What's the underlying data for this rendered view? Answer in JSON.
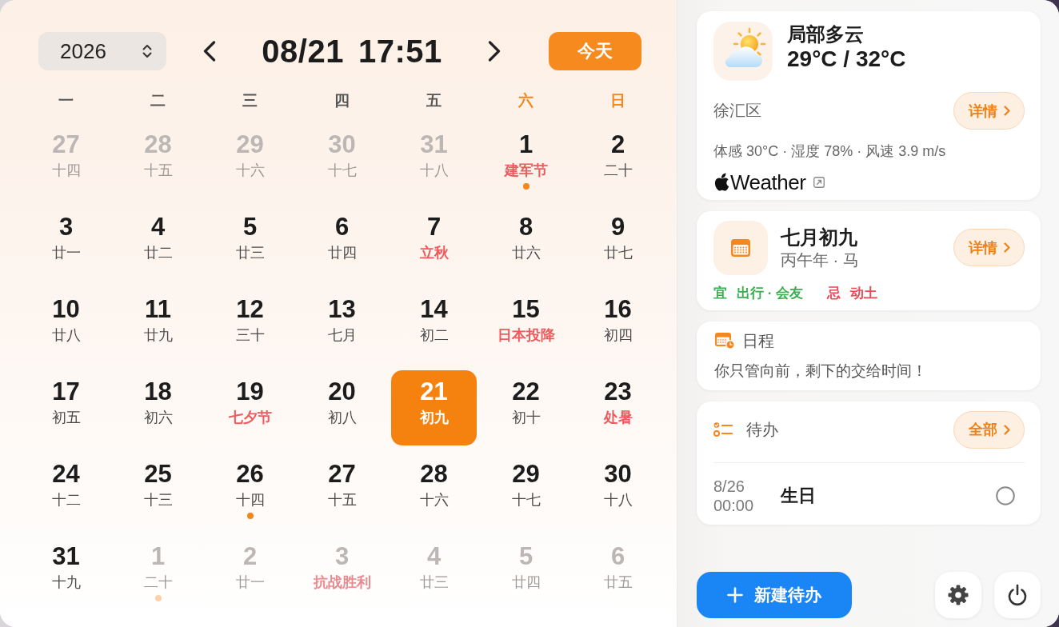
{
  "header": {
    "year": "2026",
    "date": "08/21",
    "time": "17:51",
    "today_button": "今天"
  },
  "weekdays": [
    {
      "label": "一",
      "weekend": false
    },
    {
      "label": "二",
      "weekend": false
    },
    {
      "label": "三",
      "weekend": false
    },
    {
      "label": "四",
      "weekend": false
    },
    {
      "label": "五",
      "weekend": false
    },
    {
      "label": "六",
      "weekend": true
    },
    {
      "label": "日",
      "weekend": true
    }
  ],
  "days": [
    {
      "day": "27",
      "lunar": "十四",
      "in_month": false,
      "festival": false,
      "event": false,
      "selected": false
    },
    {
      "day": "28",
      "lunar": "十五",
      "in_month": false,
      "festival": false,
      "event": false,
      "selected": false
    },
    {
      "day": "29",
      "lunar": "十六",
      "in_month": false,
      "festival": false,
      "event": false,
      "selected": false
    },
    {
      "day": "30",
      "lunar": "十七",
      "in_month": false,
      "festival": false,
      "event": false,
      "selected": false
    },
    {
      "day": "31",
      "lunar": "十八",
      "in_month": false,
      "festival": false,
      "event": false,
      "selected": false
    },
    {
      "day": "1",
      "lunar": "建军节",
      "in_month": true,
      "festival": true,
      "event": true,
      "selected": false
    },
    {
      "day": "2",
      "lunar": "二十",
      "in_month": true,
      "festival": false,
      "event": false,
      "selected": false
    },
    {
      "day": "3",
      "lunar": "廿一",
      "in_month": true,
      "festival": false,
      "event": false,
      "selected": false
    },
    {
      "day": "4",
      "lunar": "廿二",
      "in_month": true,
      "festival": false,
      "event": false,
      "selected": false
    },
    {
      "day": "5",
      "lunar": "廿三",
      "in_month": true,
      "festival": false,
      "event": false,
      "selected": false
    },
    {
      "day": "6",
      "lunar": "廿四",
      "in_month": true,
      "festival": false,
      "event": false,
      "selected": false
    },
    {
      "day": "7",
      "lunar": "立秋",
      "in_month": true,
      "festival": true,
      "event": false,
      "selected": false
    },
    {
      "day": "8",
      "lunar": "廿六",
      "in_month": true,
      "festival": false,
      "event": false,
      "selected": false
    },
    {
      "day": "9",
      "lunar": "廿七",
      "in_month": true,
      "festival": false,
      "event": false,
      "selected": false
    },
    {
      "day": "10",
      "lunar": "廿八",
      "in_month": true,
      "festival": false,
      "event": false,
      "selected": false
    },
    {
      "day": "11",
      "lunar": "廿九",
      "in_month": true,
      "festival": false,
      "event": false,
      "selected": false
    },
    {
      "day": "12",
      "lunar": "三十",
      "in_month": true,
      "festival": false,
      "event": false,
      "selected": false
    },
    {
      "day": "13",
      "lunar": "七月",
      "in_month": true,
      "festival": false,
      "event": false,
      "selected": false
    },
    {
      "day": "14",
      "lunar": "初二",
      "in_month": true,
      "festival": false,
      "event": false,
      "selected": false
    },
    {
      "day": "15",
      "lunar": "日本投降",
      "in_month": true,
      "festival": true,
      "event": false,
      "selected": false
    },
    {
      "day": "16",
      "lunar": "初四",
      "in_month": true,
      "festival": false,
      "event": false,
      "selected": false
    },
    {
      "day": "17",
      "lunar": "初五",
      "in_month": true,
      "festival": false,
      "event": false,
      "selected": false
    },
    {
      "day": "18",
      "lunar": "初六",
      "in_month": true,
      "festival": false,
      "event": false,
      "selected": false
    },
    {
      "day": "19",
      "lunar": "七夕节",
      "in_month": true,
      "festival": true,
      "event": false,
      "selected": false
    },
    {
      "day": "20",
      "lunar": "初八",
      "in_month": true,
      "festival": false,
      "event": false,
      "selected": false
    },
    {
      "day": "21",
      "lunar": "初九",
      "in_month": true,
      "festival": false,
      "event": false,
      "selected": true
    },
    {
      "day": "22",
      "lunar": "初十",
      "in_month": true,
      "festival": false,
      "event": false,
      "selected": false
    },
    {
      "day": "23",
      "lunar": "处暑",
      "in_month": true,
      "festival": true,
      "event": false,
      "selected": false
    },
    {
      "day": "24",
      "lunar": "十二",
      "in_month": true,
      "festival": false,
      "event": false,
      "selected": false
    },
    {
      "day": "25",
      "lunar": "十三",
      "in_month": true,
      "festival": false,
      "event": false,
      "selected": false
    },
    {
      "day": "26",
      "lunar": "十四",
      "in_month": true,
      "festival": false,
      "event": true,
      "selected": false
    },
    {
      "day": "27",
      "lunar": "十五",
      "in_month": true,
      "festival": false,
      "event": false,
      "selected": false
    },
    {
      "day": "28",
      "lunar": "十六",
      "in_month": true,
      "festival": false,
      "event": false,
      "selected": false
    },
    {
      "day": "29",
      "lunar": "十七",
      "in_month": true,
      "festival": false,
      "event": false,
      "selected": false
    },
    {
      "day": "30",
      "lunar": "十八",
      "in_month": true,
      "festival": false,
      "event": false,
      "selected": false
    },
    {
      "day": "31",
      "lunar": "十九",
      "in_month": true,
      "festival": false,
      "event": false,
      "selected": false
    },
    {
      "day": "1",
      "lunar": "二十",
      "in_month": false,
      "festival": false,
      "event": true,
      "selected": false
    },
    {
      "day": "2",
      "lunar": "廿一",
      "in_month": false,
      "festival": false,
      "event": false,
      "selected": false
    },
    {
      "day": "3",
      "lunar": "抗战胜利",
      "in_month": false,
      "festival": true,
      "event": false,
      "selected": false
    },
    {
      "day": "4",
      "lunar": "廿三",
      "in_month": false,
      "festival": false,
      "event": false,
      "selected": false
    },
    {
      "day": "5",
      "lunar": "廿四",
      "in_month": false,
      "festival": false,
      "event": false,
      "selected": false
    },
    {
      "day": "6",
      "lunar": "廿五",
      "in_month": false,
      "festival": false,
      "event": false,
      "selected": false
    }
  ],
  "weather": {
    "condition": "局部多云",
    "temperature": "29°C / 32°C",
    "district": "徐汇区",
    "details_button": "详情",
    "metrics": "体感 30°C · 湿度 78% · 风速 3.9 m/s",
    "source": "Weather"
  },
  "lunar_card": {
    "date": "七月初九",
    "year": "丙午年 · 马",
    "details_button": "详情",
    "good_label": "宜",
    "good": "出行 · 会友",
    "bad_label": "忌",
    "bad": "动土"
  },
  "schedule": {
    "title": "日程",
    "text": "你只管向前，剩下的交给时间！"
  },
  "todos": {
    "title": "待办",
    "all_button": "全部",
    "items": [
      {
        "date": "8/26",
        "time": "00:00",
        "title": "生日",
        "done": false
      }
    ]
  },
  "new_todo_button": "新建待办"
}
